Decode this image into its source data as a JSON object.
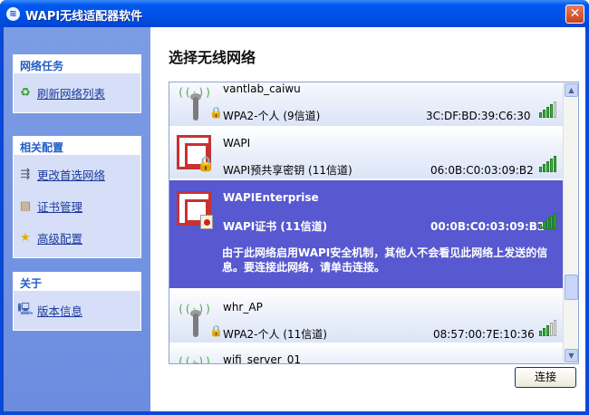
{
  "window": {
    "title": "WAPI无线适配器软件",
    "close_label": "✕"
  },
  "sidebar": {
    "panels": [
      {
        "heading": "网络任务",
        "items": [
          {
            "label": "刷新网络列表",
            "icon": "refresh-icon"
          }
        ]
      },
      {
        "heading": "相关配置",
        "items": [
          {
            "label": "更改首选网络",
            "icon": "network-cards-icon"
          },
          {
            "label": "证书管理",
            "icon": "certificate-icon"
          },
          {
            "label": "高级配置",
            "icon": "star-icon"
          }
        ]
      },
      {
        "heading": "关于",
        "items": [
          {
            "label": "版本信息",
            "icon": "computer-info-icon"
          }
        ]
      }
    ]
  },
  "main": {
    "title": "选择无线网络",
    "connect_label": "连接",
    "networks": [
      {
        "ssid": "vantlab_caiwu",
        "security": "WPA2-个人 (9信道)",
        "mac": "3C:DF:BD:39:C6:30",
        "signal_bars": 4
      },
      {
        "ssid": "WAPI",
        "security": "WAPI预共享密钥 (11信道)",
        "mac": "06:0B:C0:03:09:B2",
        "signal_bars": 5
      },
      {
        "ssid": "WAPIEnterprise",
        "security": "WAPI证书 (11信道)",
        "mac": "00:0B:C0:03:09:B2",
        "signal_bars": 5,
        "selected": true,
        "description": "由于此网络启用WAPI安全机制，其他人不会看见此网络上发送的信息。要连接此网络，请单击连接。"
      },
      {
        "ssid": "whr_AP",
        "security": "WPA2-个人 (11信道)",
        "mac": "08:57:00:7E:10:36",
        "signal_bars": 3
      },
      {
        "ssid": "wifi_server_01",
        "security": "",
        "mac": "",
        "signal_bars": 0
      }
    ]
  },
  "colors": {
    "selected_row": "#5858d0",
    "sidebar": "#7c9ce4",
    "titlebar": "#0058ee",
    "link": "#1d3a9a"
  }
}
